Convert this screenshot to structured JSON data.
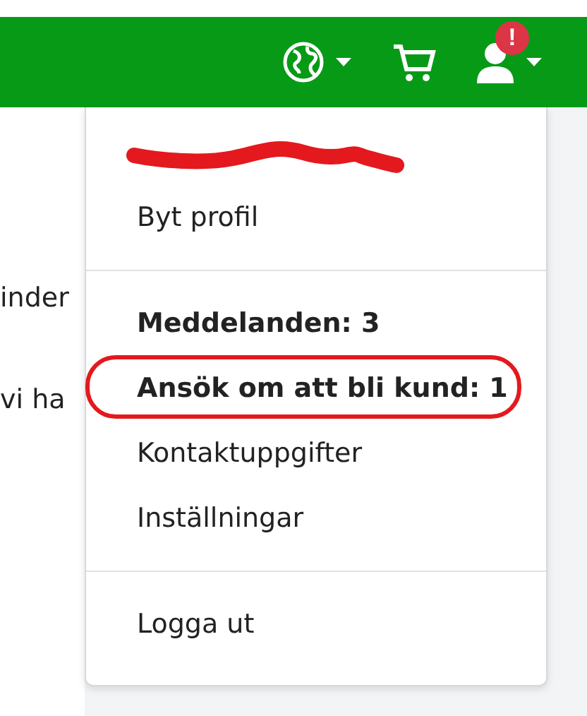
{
  "navbar": {
    "icons": [
      {
        "kind": "globe",
        "caret": true
      },
      {
        "kind": "cart",
        "caret": false
      },
      {
        "kind": "user",
        "caret": true,
        "badge": "!"
      }
    ]
  },
  "page_text": [
    "inder",
    "vi ha"
  ],
  "menu": {
    "sections": [
      [
        {
          "kind": "redacted"
        },
        {
          "kind": "item",
          "label": "Byt profil",
          "bold": false,
          "circled": false
        }
      ],
      [
        {
          "kind": "item",
          "label": "Meddelanden: 3",
          "bold": true,
          "circled": false
        },
        {
          "kind": "item",
          "label": "Ansök om att bli kund: 1",
          "bold": true,
          "circled": true
        },
        {
          "kind": "item",
          "label": "Kontaktuppgifter",
          "bold": false,
          "circled": false
        },
        {
          "kind": "item",
          "label": "Inställningar",
          "bold": false,
          "circled": false
        }
      ],
      [
        {
          "kind": "item",
          "label": "Logga ut",
          "bold": false,
          "circled": false
        }
      ]
    ]
  }
}
